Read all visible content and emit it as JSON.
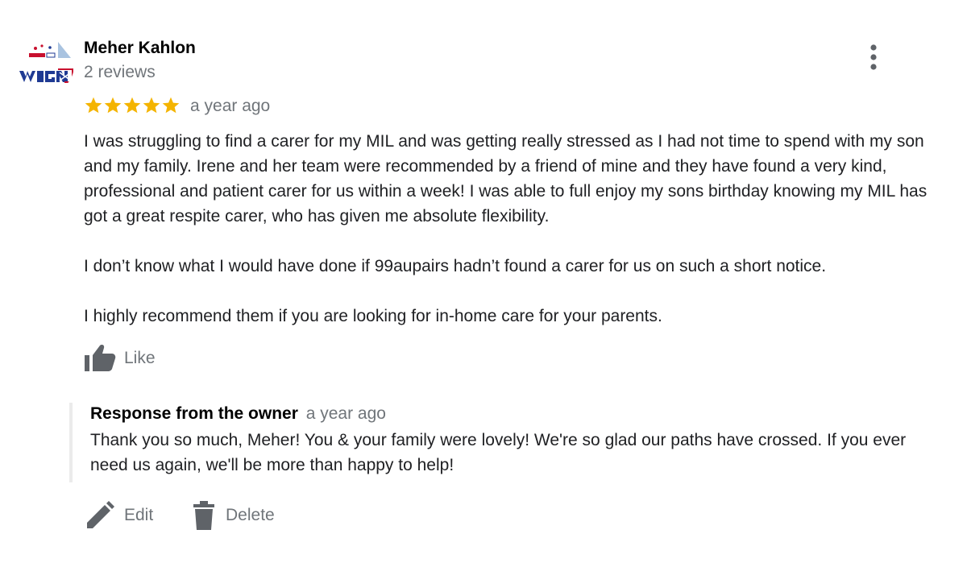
{
  "review": {
    "reviewer_name": "Meher Kahlon",
    "reviewer_meta": "2 reviews",
    "rating": 5,
    "rating_max": 5,
    "date": "a year ago",
    "paragraphs": [
      "I was struggling to find a carer for my MIL and was getting really stressed as I had not time to spend with my son and my family. Irene and her team were recommended by a friend of mine and they have found a very kind, professional and patient carer for us within a week! I was able to full enjoy my sons birthday knowing my MIL has got a great respite carer, who has given me absolute flexibility.",
      "I don’t know what I would have done if 99aupairs hadn’t found a carer for us on such a short notice.",
      "I highly recommend them if you are looking for in-home care for your parents."
    ],
    "like_label": "Like"
  },
  "owner_response": {
    "title": "Response from the owner",
    "date": "a year ago",
    "text": "Thank you so much, Meher! You & your family were lovely! We're so glad our paths have crossed. If you ever need us again, we'll be more than happy to help!"
  },
  "actions": {
    "edit_label": "Edit",
    "delete_label": "Delete"
  },
  "icons": {
    "more": "more-vert-icon",
    "star": "star-icon",
    "like": "thumb-up-icon",
    "edit": "pencil-icon",
    "delete": "trash-icon"
  },
  "colors": {
    "star": "#f4b400",
    "secondary_text": "#70757a",
    "icon_gray": "#5f6368",
    "response_border": "#ebebeb"
  }
}
